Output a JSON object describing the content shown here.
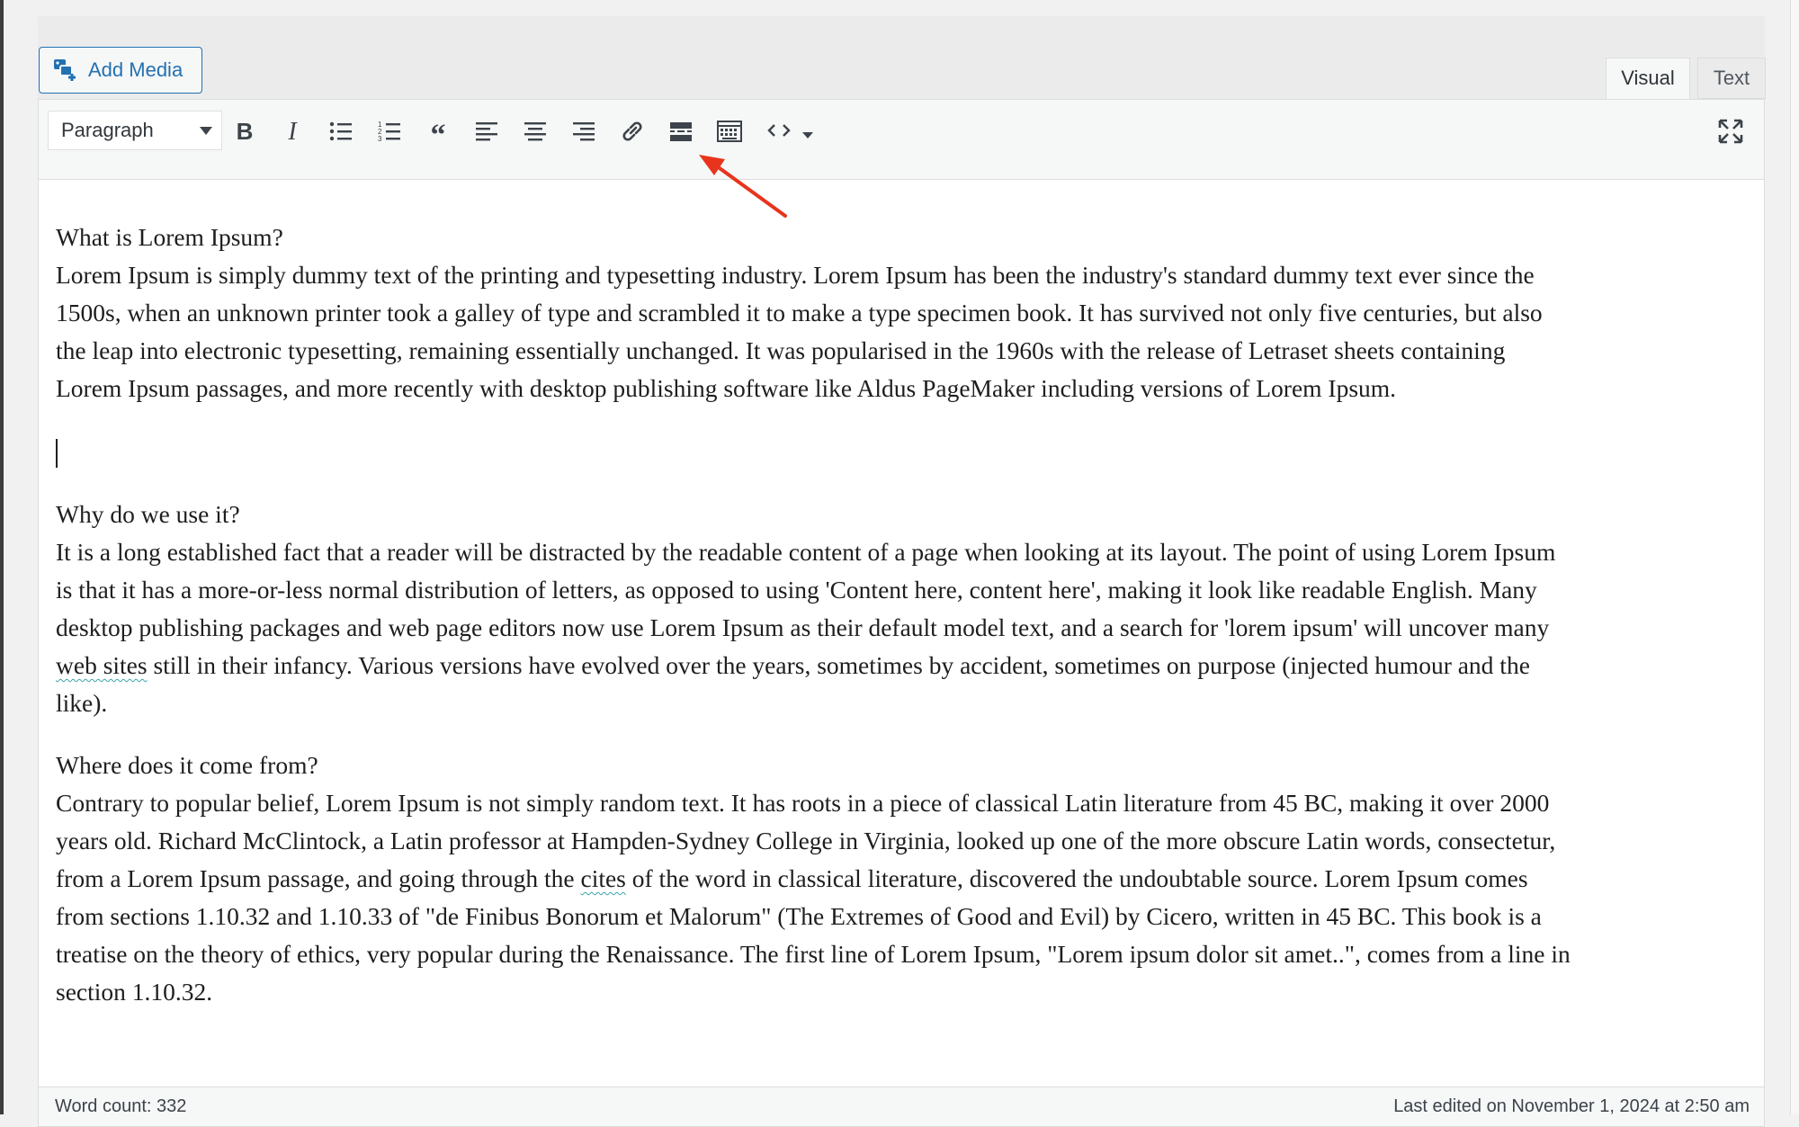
{
  "editor": {
    "add_media_label": "Add Media",
    "tabs": {
      "visual": "Visual",
      "text": "Text"
    },
    "format_select": "Paragraph",
    "status": {
      "word_count": "Word count: 332",
      "last_edited": "Last edited on November 1, 2024 at 2:50 am"
    }
  },
  "icons": [
    "add-media-icon",
    "bold-icon",
    "italic-icon",
    "bulleted-list-icon",
    "numbered-list-icon",
    "blockquote-icon",
    "align-left-icon",
    "align-center-icon",
    "align-right-icon",
    "link-icon",
    "read-more-icon",
    "toolbar-toggle-icon",
    "code-icon",
    "dropdown-caret-icon",
    "fullscreen-icon"
  ],
  "colors": {
    "accent": "#2271b1",
    "arrow": "#e8341c"
  },
  "content": {
    "h1": "What is Lorem Ipsum?",
    "p1_lines": [
      "Lorem Ipsum is simply dummy text of the printing and typesetting industry. Lorem Ipsum has been the industry's standard dummy text ever since the",
      "1500s, when an unknown printer took a galley of type and scrambled it to make a type specimen book. It has survived not only five centuries, but also",
      "the leap into electronic typesetting, remaining essentially unchanged. It was popularised in the 1960s with the release of Letraset sheets containing",
      "Lorem Ipsum passages, and more recently with desktop publishing software like Aldus PageMaker including versions of Lorem Ipsum."
    ],
    "h2": "Why do we use it?",
    "p2_lines": [
      "It is a long established fact that a reader will be distracted by the readable content of a page when looking at its layout. The point of using Lorem Ipsum",
      "is that it has a more-or-less normal distribution of letters, as opposed to using 'Content here, content here', making it look like readable English. Many",
      "desktop publishing packages and web page editors now use Lorem Ipsum as their default model text, and a search for 'lorem ipsum' will uncover many"
    ],
    "p2_l4_squiggle": "web sites",
    "p2_l4_rest": " still in their infancy. Various versions have evolved over the years, sometimes by accident, sometimes on purpose (injected humour and the",
    "p2_l5": "like).",
    "h3": "Where does it come from?",
    "p3_lines": [
      "Contrary to popular belief, Lorem Ipsum is not simply random text. It has roots in a piece of classical Latin literature from 45 BC, making it over 2000",
      "years old. Richard McClintock, a Latin professor at Hampden-Sydney College in Virginia, looked up one of the more obscure Latin words, consectetur,"
    ],
    "p3_l3_pre": "from a Lorem Ipsum passage, and going through the ",
    "p3_l3_squiggle": "cites",
    "p3_l3_post": " of the word in classical literature, discovered the undoubtable source. Lorem Ipsum comes",
    "p3_lines_b": [
      "from sections 1.10.32 and 1.10.33 of \"de Finibus Bonorum et Malorum\" (The Extremes of Good and Evil) by Cicero, written in 45 BC. This book is a",
      "treatise on the theory of ethics, very popular during the Renaissance. The first line of Lorem Ipsum, \"Lorem ipsum dolor sit amet..\", comes from a line in",
      "section 1.10.32."
    ]
  }
}
